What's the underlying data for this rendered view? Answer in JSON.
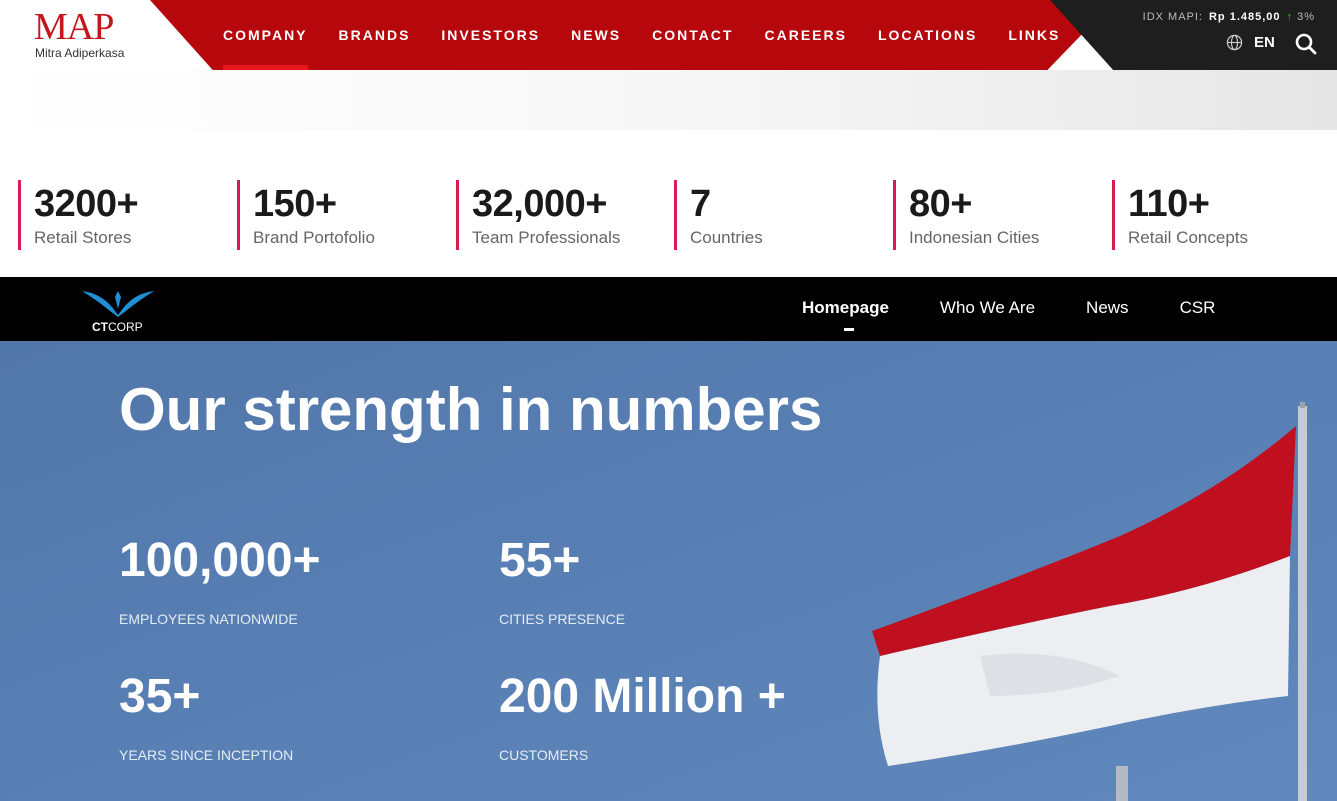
{
  "brand": {
    "name": "MAP",
    "subtitle": "Mitra Adiperkasa"
  },
  "nav": [
    "COMPANY",
    "BRANDS",
    "INVESTORS",
    "NEWS",
    "CONTACT",
    "CAREERS",
    "LOCATIONS",
    "LINKS"
  ],
  "ticker": {
    "label": "IDX MAPI:",
    "price": "Rp 1.485,00",
    "arrow": "↑",
    "change": "3%"
  },
  "lang": "EN",
  "stats": [
    {
      "num": "3200+",
      "label": "Retail Stores"
    },
    {
      "num": "150+",
      "label": "Brand Portofolio"
    },
    {
      "num": "32,000+",
      "label": "Team Professionals"
    },
    {
      "num": "7",
      "label": "Countries"
    },
    {
      "num": "80+",
      "label": "Indonesian Cities"
    },
    {
      "num": "110+",
      "label": "Retail Concepts"
    }
  ],
  "ctcorp": {
    "logo": {
      "bold": "CT",
      "rest": "CORP"
    },
    "nav": [
      "Homepage",
      "Who We Are",
      "News",
      "CSR"
    ]
  },
  "hero": {
    "title": "Our strength in numbers",
    "kpis": [
      {
        "value": "100,000+",
        "label": "EMPLOYEES NATIONWIDE"
      },
      {
        "value": "55+",
        "label": "CITIES PRESENCE"
      },
      {
        "value": "35+",
        "label": "YEARS SINCE INCEPTION"
      },
      {
        "value": "200 Million +",
        "label": "CUSTOMERS"
      }
    ]
  },
  "colors": {
    "brand_red": "#b5070c",
    "accent_pink": "#d81b50",
    "sky": "#577eb3"
  }
}
